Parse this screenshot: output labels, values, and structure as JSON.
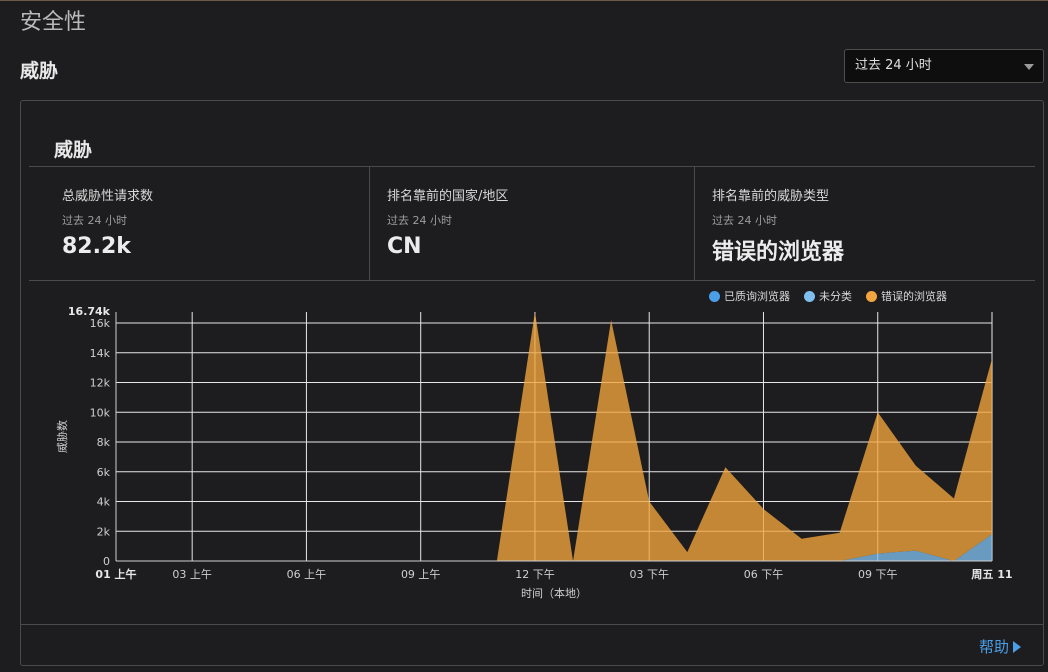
{
  "page": {
    "title": "安全性",
    "section_title": "威胁"
  },
  "time_select": {
    "value": "过去 24 小时"
  },
  "panel": {
    "title": "威胁",
    "stats": [
      {
        "label": "总威胁性请求数",
        "sub": "过去 24 小时",
        "value": "82.2k"
      },
      {
        "label": "排名靠前的国家/地区",
        "sub": "过去 24 小时",
        "value": "CN"
      },
      {
        "label": "排名靠前的威胁类型",
        "sub": "过去 24 小时",
        "value": "错误的浏览器"
      }
    ],
    "help": "帮助"
  },
  "colors": {
    "accent": "#4a9fe8",
    "queried": "#4a9fe8",
    "unclassified": "#7fbff0",
    "bad_browser": "#f2a53e"
  },
  "chart_data": {
    "type": "area",
    "ylabel": "威胁数",
    "xlabel": "时间（本地）",
    "ylim": [
      0,
      16740
    ],
    "y_max_label": "16.74k",
    "y_ticks": [
      {
        "value": 0,
        "label": "0"
      },
      {
        "value": 2000,
        "label": "2k"
      },
      {
        "value": 4000,
        "label": "4k"
      },
      {
        "value": 6000,
        "label": "6k"
      },
      {
        "value": 8000,
        "label": "8k"
      },
      {
        "value": 10000,
        "label": "10k"
      },
      {
        "value": 12000,
        "label": "12k"
      },
      {
        "value": 14000,
        "label": "14k"
      },
      {
        "value": 16000,
        "label": "16k"
      }
    ],
    "x_ticks": [
      {
        "hour": 0,
        "label": "01 上午",
        "bold": true
      },
      {
        "hour": 2,
        "label": "03 上午"
      },
      {
        "hour": 5,
        "label": "06 上午"
      },
      {
        "hour": 8,
        "label": "09 上午"
      },
      {
        "hour": 11,
        "label": "12 下午"
      },
      {
        "hour": 14,
        "label": "03 下午"
      },
      {
        "hour": 17,
        "label": "06 下午"
      },
      {
        "hour": 20,
        "label": "09 下午"
      },
      {
        "hour": 23,
        "label": "周五 11",
        "bold": true
      }
    ],
    "x_range": [
      0,
      23
    ],
    "legend": "top-right",
    "grid": true,
    "series": [
      {
        "name": "已质询浏览器",
        "color": "#4a9fe8",
        "points": [
          [
            0,
            0
          ],
          [
            10,
            0
          ],
          [
            11,
            0
          ],
          [
            12,
            0
          ],
          [
            13,
            0
          ],
          [
            14,
            0
          ],
          [
            15,
            0
          ],
          [
            16,
            0
          ],
          [
            17,
            0
          ],
          [
            18,
            0
          ],
          [
            19,
            0
          ],
          [
            20,
            0
          ],
          [
            21,
            0
          ],
          [
            22,
            0
          ],
          [
            23,
            0
          ]
        ]
      },
      {
        "name": "未分类",
        "color": "#7fbff0",
        "points": [
          [
            0,
            0
          ],
          [
            10,
            0
          ],
          [
            11,
            0
          ],
          [
            12,
            0
          ],
          [
            13,
            0
          ],
          [
            14,
            0
          ],
          [
            15,
            0
          ],
          [
            16,
            0
          ],
          [
            17,
            0
          ],
          [
            18,
            0
          ],
          [
            19,
            0
          ],
          [
            20,
            500
          ],
          [
            21,
            700
          ],
          [
            22,
            0
          ],
          [
            23,
            1800
          ]
        ]
      },
      {
        "name": "错误的浏览器",
        "color": "#f2a53e",
        "points": [
          [
            0,
            0
          ],
          [
            10,
            0
          ],
          [
            11,
            16740
          ],
          [
            12,
            0
          ],
          [
            13,
            16200
          ],
          [
            14,
            4000
          ],
          [
            15,
            600
          ],
          [
            16,
            6300
          ],
          [
            17,
            3500
          ],
          [
            18,
            1500
          ],
          [
            19,
            1900
          ],
          [
            20,
            9500
          ],
          [
            21,
            5700
          ],
          [
            22,
            4200
          ],
          [
            23,
            11800
          ]
        ]
      }
    ]
  }
}
